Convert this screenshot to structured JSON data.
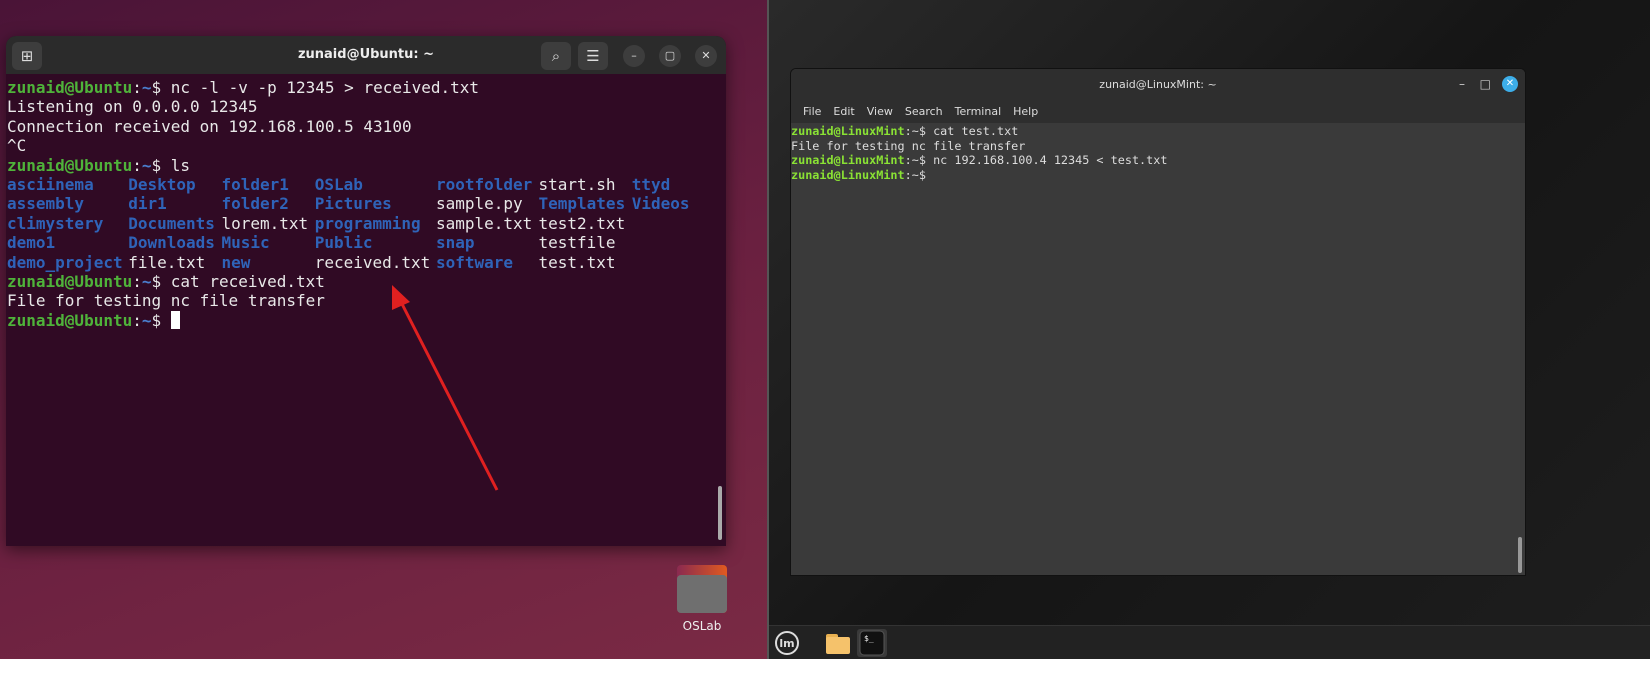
{
  "ubuntu_terminal": {
    "title": "zunaid@Ubuntu: ~",
    "prompt_user": "zunaid@Ubuntu",
    "prompt_path": "~",
    "lines": [
      {
        "type": "cmd",
        "text": "nc -l -v -p 12345 > received.txt"
      },
      {
        "type": "out",
        "text": "Listening on 0.0.0.0 12345"
      },
      {
        "type": "out",
        "text": "Connection received on 192.168.100.5 43100"
      },
      {
        "type": "out",
        "text": "^C"
      },
      {
        "type": "cmd",
        "text": "ls"
      }
    ],
    "ls": [
      [
        [
          "asciinema",
          "d"
        ],
        [
          "Desktop",
          "d"
        ],
        [
          "folder1",
          "d"
        ],
        [
          "OSLab",
          "d"
        ],
        [
          "rootfolder",
          "d"
        ],
        [
          "start.sh",
          "f"
        ],
        [
          "ttyd",
          "d"
        ]
      ],
      [
        [
          "assembly",
          "d"
        ],
        [
          "dir1",
          "d"
        ],
        [
          "folder2",
          "d"
        ],
        [
          "Pictures",
          "d"
        ],
        [
          "sample.py",
          "f"
        ],
        [
          "Templates",
          "d"
        ],
        [
          "Videos",
          "d"
        ]
      ],
      [
        [
          "climystery",
          "d"
        ],
        [
          "Documents",
          "d"
        ],
        [
          "lorem.txt",
          "f"
        ],
        [
          "programming",
          "d"
        ],
        [
          "sample.txt",
          "f"
        ],
        [
          "test2.txt",
          "f"
        ],
        [
          "",
          ""
        ]
      ],
      [
        [
          "demo1",
          "d"
        ],
        [
          "Downloads",
          "d"
        ],
        [
          "Music",
          "d"
        ],
        [
          "Public",
          "d"
        ],
        [
          "snap",
          "d"
        ],
        [
          "testfile",
          "f"
        ],
        [
          "",
          ""
        ]
      ],
      [
        [
          "demo_project",
          "d"
        ],
        [
          "file.txt",
          "f"
        ],
        [
          "new",
          "d"
        ],
        [
          "received.txt",
          "f"
        ],
        [
          "software",
          "d"
        ],
        [
          "test.txt",
          "f"
        ],
        [
          "",
          ""
        ]
      ]
    ],
    "after": [
      {
        "type": "cmd",
        "text": "cat received.txt"
      },
      {
        "type": "out",
        "text": "File for testing nc file transfer"
      },
      {
        "type": "cmd",
        "text": ""
      }
    ]
  },
  "mint_terminal": {
    "title": "zunaid@LinuxMint: ~",
    "menu": [
      "File",
      "Edit",
      "View",
      "Search",
      "Terminal",
      "Help"
    ],
    "prompt_user": "zunaid@LinuxMint",
    "prompt_path": "~",
    "lines": [
      {
        "type": "cmd",
        "text": "cat test.txt"
      },
      {
        "type": "out",
        "text": "File for testing nc file transfer"
      },
      {
        "type": "cmd",
        "text": "nc 192.168.100.4 12345 < test.txt"
      },
      {
        "type": "cmd",
        "text": ""
      }
    ]
  },
  "desktop": {
    "folder_label": "OSLab"
  },
  "colors": {
    "annotation_arrow": "#e02020",
    "ubuntu_bg": "#300a24"
  }
}
